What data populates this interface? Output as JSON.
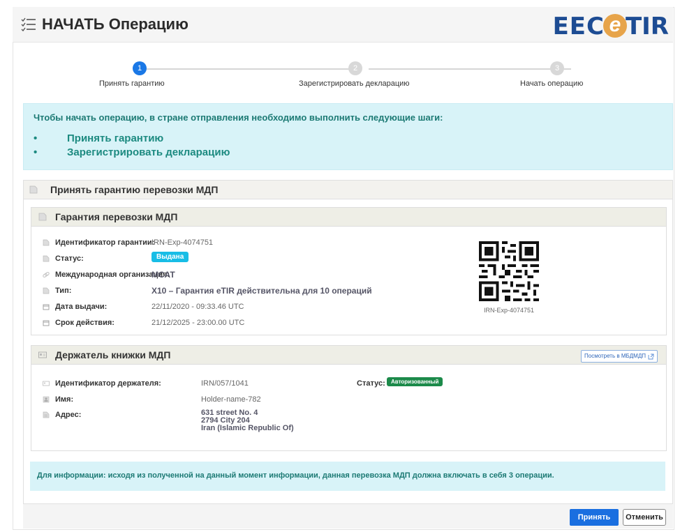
{
  "header": {
    "title": "НАЧАТЬ Операцию",
    "logo": {
      "left": "EEC",
      "middle": "e",
      "right": "TIR"
    }
  },
  "stepper": {
    "steps": [
      {
        "number": "1",
        "label": "Принять гарантию",
        "state": "active"
      },
      {
        "number": "2",
        "label": "Зарегистрировать декларацию",
        "state": "inactive"
      },
      {
        "number": "3",
        "label": "Начать операцию",
        "state": "inactive"
      }
    ]
  },
  "info": {
    "title": "Чтобы начать операцию, в стране отправления необходимо выполнить следующие шаги:",
    "bullet": "•",
    "items": [
      "Принять гарантию",
      "Зарегистрировать декларацию"
    ]
  },
  "panel": {
    "title": "Принять гарантию перевозки МДП"
  },
  "guarantee": {
    "title": "Гарантия перевозки МДП",
    "fields": [
      {
        "label": "Идентификатор гарантии:",
        "value": "IRN-Exp-4074751"
      },
      {
        "label": "Статус:",
        "value": "Выдана"
      },
      {
        "label": "Международная организация:",
        "value": "МСАТ"
      },
      {
        "label": "Тип:",
        "value": "X10 – Гарантия eTIR действительна для 10 операций"
      },
      {
        "label": "Дата выдачи:",
        "value": "22/11/2020 - 09:33.46 UTC"
      },
      {
        "label": "Срок действия:",
        "value": "21/12/2025 - 23:00.00 UTC"
      }
    ],
    "qr_caption": "IRN-Exp-4074751"
  },
  "holder": {
    "title": "Держатель книжки МДП",
    "view_button": "Посмотреть в МБДМДП",
    "fields": [
      {
        "label": "Идентификатор держателя:",
        "value": "IRN/057/1041"
      },
      {
        "label": "Имя:",
        "value": "Holder-name-782"
      },
      {
        "label": "Адрес:",
        "value_lines": [
          "631 street No. 4",
          "2794 City 204",
          "Iran (Islamic Republic Of)"
        ]
      }
    ],
    "status_label": "Статус:",
    "status_value": "Авторизованный"
  },
  "note": {
    "text": "Для информации: исходя из полученной на данный момент информации, данная перевозка МДП должна включать в себя 3 операции."
  },
  "footer": {
    "accept": "Принять",
    "cancel": "Отменить"
  },
  "colors": {
    "accent": "#1a78e6",
    "info_bg": "#d8f3f8",
    "info_text": "#1c7a74",
    "badge_issued": "#18bde6",
    "badge_authorized": "#1c8a4a",
    "logo_blue": "#1d4c93",
    "logo_orange": "#e7a44a"
  }
}
